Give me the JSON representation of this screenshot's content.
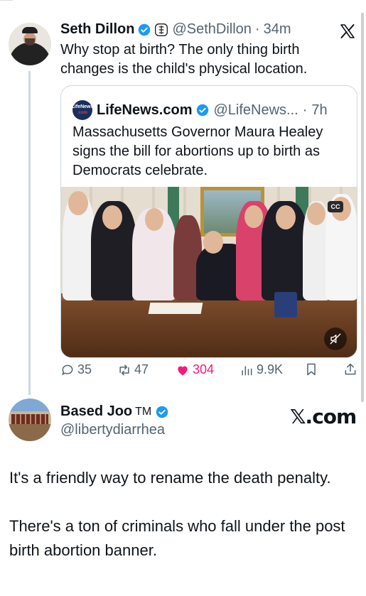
{
  "tweet1": {
    "name": "Seth Dillon",
    "handle": "@SethDillon",
    "separator": "·",
    "time": "34m",
    "text": "Why stop at birth? The only thing birth changes is the child's physical location.",
    "quote": {
      "avatar_line1": "LifeNews",
      "avatar_line2": ".com",
      "name": "LifeNews.com",
      "handle": "@LifeNews...",
      "separator": "·",
      "time": "7h",
      "text": "Massachusetts Governor Maura Healey signs the bill for abortions up to birth as Democrats celebrate.",
      "media_cc_label": "CC"
    },
    "actions": {
      "replies": "35",
      "reposts": "47",
      "likes": "304",
      "views": "9.9K"
    }
  },
  "watermark": "𝕏.com",
  "tweet2": {
    "name": "Based Joo",
    "tm": "TM",
    "handle": "@libertydiarrhea",
    "paragraph1": "It's a friendly way to rename the death penalty.",
    "paragraph2": "There's a ton of criminals who fall under the post birth abortion banner."
  },
  "colors": {
    "verified": "#1d9bf0",
    "like": "#f91880",
    "muted_text": "#536471",
    "thread_line": "#cfd9de"
  }
}
